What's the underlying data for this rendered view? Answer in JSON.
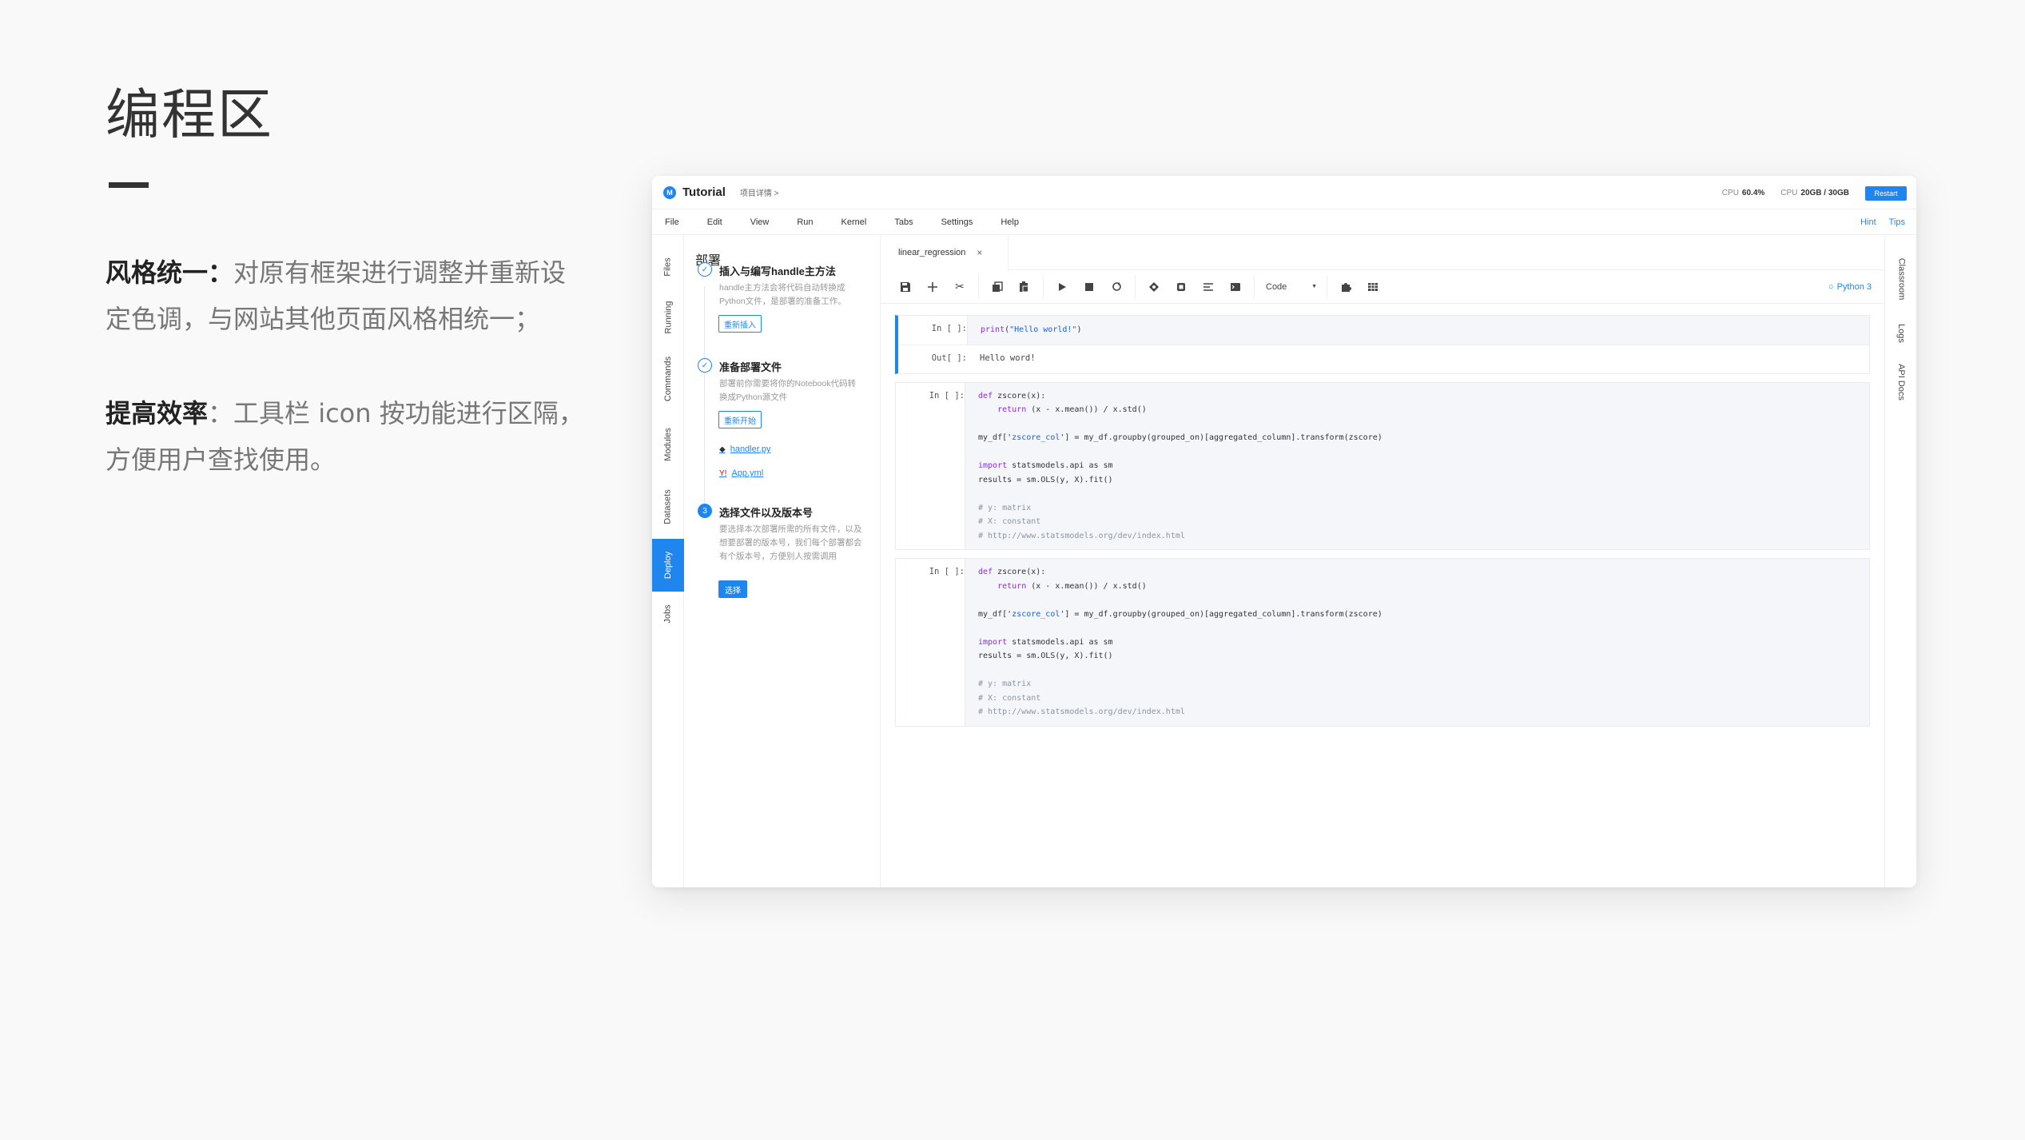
{
  "slide": {
    "title": "编程区",
    "desc1_strong": "风格统一：",
    "desc1_text": "对原有框架进行调整并重新设定色调，与网站其他页面风格相统一；",
    "desc2_strong": "提高效率",
    "desc2_text": "：工具栏 icon 按功能进行区隔，方便用户查找使用。"
  },
  "app": {
    "logo": "M",
    "name": "Tutorial",
    "breadcrumb": "项目详情 >",
    "cpu_label": "CPU",
    "cpu_value": "60.4%",
    "mem_label": "CPU",
    "mem_value": "20GB / 30GB",
    "restart": "Restart",
    "accent": "#1f86f0"
  },
  "menu": {
    "items": [
      "File",
      "Edit",
      "View",
      "Run",
      "Kernel",
      "Tabs",
      "Settings",
      "Help"
    ],
    "hint": "Hint",
    "tips": "Tips"
  },
  "left_sidebar": {
    "tabs": [
      "Files",
      "Running",
      "Commands",
      "Modules",
      "Datasets",
      "Deploy",
      "Jobs"
    ],
    "active": "Deploy"
  },
  "right_sidebar": {
    "tabs": [
      "Classroom",
      "Logs",
      "API Docs"
    ]
  },
  "deploy": {
    "title": "部署",
    "step1": {
      "title": "插入与编写handle主方法",
      "desc": "handle主方法会将代码自动转换成Python文件，是部署的准备工作。",
      "button": "重新插入"
    },
    "step2": {
      "title": "准备部署文件",
      "desc": "部署前你需要将你的Notebook代码转换成Python源文件",
      "button": "重新开始",
      "file1": "handler.py",
      "file2": "App.yml"
    },
    "step3": {
      "number": "3",
      "title": "选择文件以及版本号",
      "desc": "要选择本次部署所需的所有文件，以及想要部署的版本号，我们每个部署都会有个版本号，方便别人按需调用",
      "button": "选择"
    }
  },
  "notebook": {
    "tab_name": "linear_regression",
    "tab_close": "×",
    "cell_type": "Code",
    "kernel": "Python 3",
    "toolbar_icons": [
      "save-icon",
      "plus-icon",
      "scissors-icon",
      "copy-icon",
      "paste-icon",
      "run-icon",
      "stop-icon",
      "restart-icon",
      "bug-icon",
      "cpu-icon",
      "format-icon",
      "terminal-icon",
      "puzzle-icon",
      "table-icon"
    ],
    "cell1": {
      "prompt_in": "In [ ]:",
      "code": "print(\"Hello world!\")",
      "prompt_out": "Out[ ]:",
      "output": "Hello word!"
    },
    "cell2": {
      "prompt_in": "In [ ]:"
    },
    "cell3": {
      "prompt_in": "In [ ]:"
    },
    "code": {
      "l1": "def zscore(x):",
      "l2": "    return (x - x.mean()) / x.std()",
      "l3a": "my_df['",
      "l3b": "zscore_col",
      "l3c": "'] = my_df.groupby(grouped_on)[aggregated_column].transform(zscore)",
      "l4a": "import",
      "l4b": " statsmodels.api as sm",
      "l5": "results = sm.OLS(y, X).fit()",
      "l6": "# y: matrix",
      "l7": "# X: constant",
      "l8": "# http://www.statsmodels.org/dev/index.html"
    }
  }
}
